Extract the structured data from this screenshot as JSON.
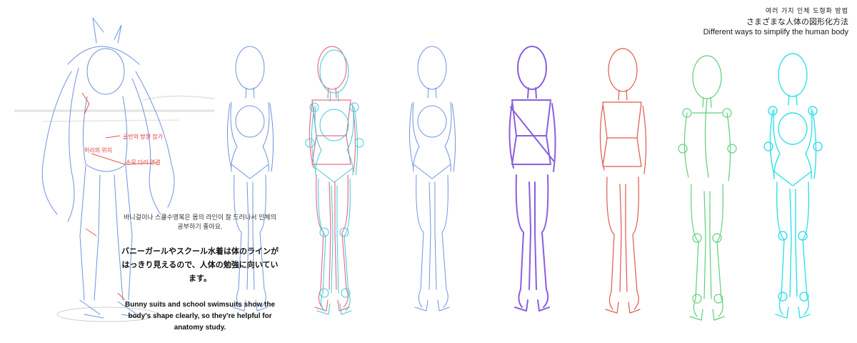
{
  "header": {
    "title_ko": "여러 가지 인체 도형화 방법",
    "title_ja": "さまざまな人体の図形化方法",
    "title_en": "Different ways to simplify the human body"
  },
  "note": {
    "korean": "바니걸이나 스쿨수영복은 몸의 라인이 잘 드러나서 인체의 공부하기 좋아요.",
    "japanese": "バニーガールやスクール水着は体のラインがはっきり見えるので、人体の勉強に向いています。",
    "english": "Bunny suits and school swimsuits show the body's shape clearly, so they're helpful for anatomy study."
  },
  "annotations": {
    "a1": "골반의 방향 잡기",
    "a2": "허리의 위치",
    "a3": "손목 다리 연결"
  },
  "colors": {
    "blue": "#6f93e0",
    "pink": "#e8708a",
    "cyan": "#3ec9d8",
    "purple": "#8a5ee0",
    "red": "#e2574a",
    "green": "#5cd07a",
    "aqua": "#32e0ea",
    "gray": "#cfcfcf"
  }
}
